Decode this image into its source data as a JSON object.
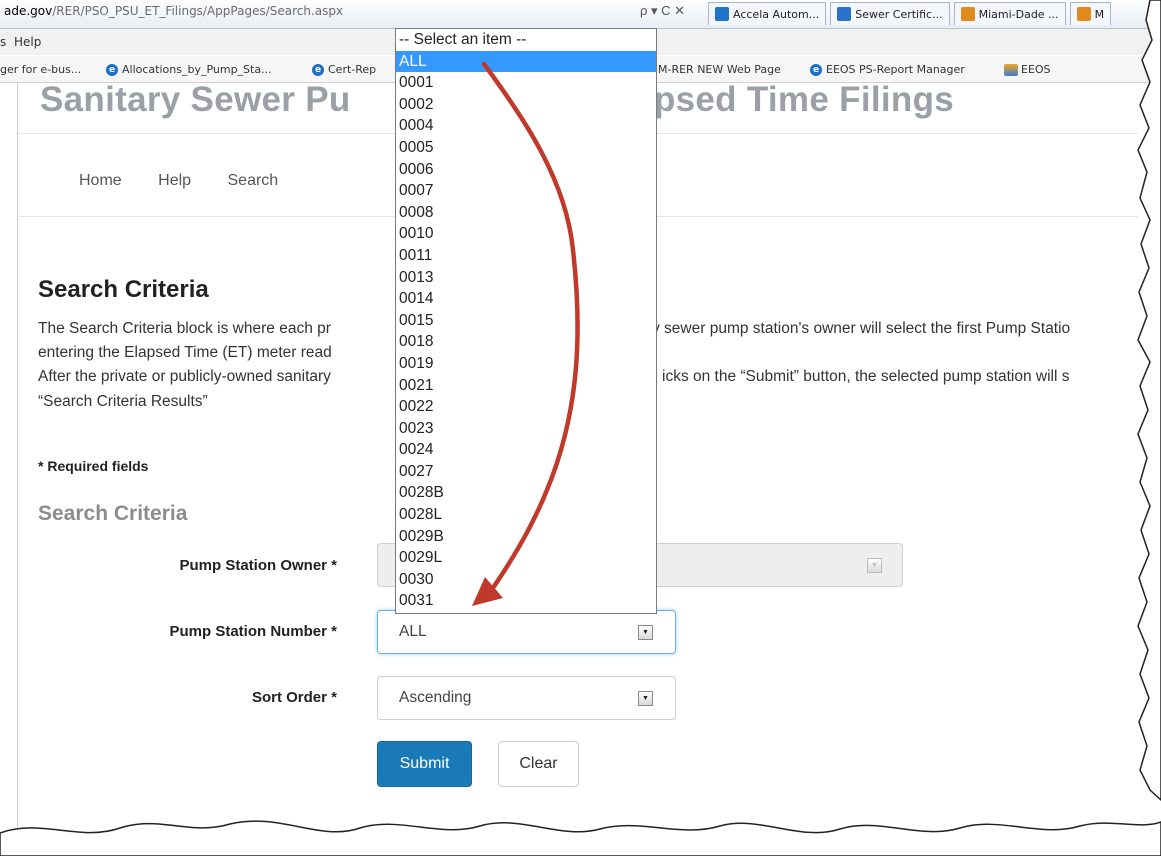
{
  "browser": {
    "url_host": "ade.gov",
    "url_path": "/RER/PSO_PSU_ET_Filings/AppPages/Search.aspx",
    "addr_controls": "ρ ▾ C ✕",
    "tabs": [
      {
        "label": "Accela Autom...",
        "icon": "accela-icon",
        "color": "#1f74c9"
      },
      {
        "label": "Sewer Certific...",
        "icon": "document-icon",
        "color": "#2a72c8"
      },
      {
        "label": "Miami-Dade ...",
        "icon": "miami-dade-icon",
        "color": "#e08a1d"
      },
      {
        "label": "M",
        "icon": "miami-dade-icon",
        "color": "#e08a1d"
      }
    ],
    "menu": {
      "partial": "s",
      "help": "Help"
    },
    "favorites": [
      {
        "label": "ger for e-bus...",
        "icon": "none"
      },
      {
        "label": "Allocations_by_Pump_Sta...",
        "icon": "ie-icon"
      },
      {
        "label": "Cert-Rep",
        "icon": "ie-icon"
      },
      {
        "label": "M-RER NEW Web Page",
        "icon": "none"
      },
      {
        "label": "EEOS PS-Report Manager",
        "icon": "ie-icon"
      },
      {
        "label": "EEOS",
        "icon": "eeos-icon"
      }
    ]
  },
  "site": {
    "title_left": "Sanitary Sewer Pu",
    "title_right": "Elapsed Time Filings",
    "nav": [
      "Home",
      "Help",
      "Search"
    ]
  },
  "content": {
    "heading": "Search Criteria",
    "para1_left": "The Search Criteria block is where each pr",
    "para1_right": "y sewer pump station's owner will select the first Pump Statio",
    "para2_left": "entering the Elapsed Time (ET) meter read",
    "para3_left": "After the private or publicly-owned sanitary",
    "para3_right": "icks on the “Submit” button, the selected pump station will s",
    "para4": "“Search Criteria Results”",
    "required": "* Required fields",
    "subheading": "Search Criteria"
  },
  "form": {
    "owner_label": "Pump Station Owner *",
    "number_label": "Pump Station Number *",
    "number_value": "ALL",
    "sort_label": "Sort Order *",
    "sort_value": "Ascending",
    "submit_label": "Submit",
    "clear_label": "Clear"
  },
  "dropdown": {
    "items": [
      "-- Select an item --",
      "ALL",
      "0001",
      "0002",
      "0004",
      "0005",
      "0006",
      "0007",
      "0008",
      "0010",
      "0011",
      "0013",
      "0014",
      "0015",
      "0018",
      "0019",
      "0021",
      "0022",
      "0023",
      "0024",
      "0027",
      "0028B",
      "0028L",
      "0029B",
      "0029L",
      "0030",
      "0031"
    ],
    "selected_index": 1
  },
  "colors": {
    "selection": "#3399ff",
    "submit": "#1a7ab8",
    "annotation_arrow": "#c0392b"
  }
}
